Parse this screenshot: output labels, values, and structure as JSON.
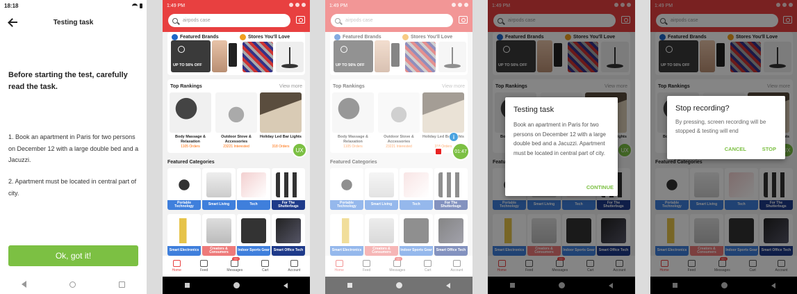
{
  "task_screen": {
    "status_time": "18:18",
    "title": "Testing task",
    "intro": "Before starting the test, carefully read the task.",
    "step1": "1. Book an apartment in Paris for two persons on December 12 with a large double bed and a Jacuzzi.",
    "step2": "2. Apartment must be located in central part of city.",
    "ok_button": "Ok, got it!"
  },
  "app": {
    "status_time": "1:49 PM",
    "search_placeholder": "airpods case",
    "featured_brands": "Featured Brands",
    "stores_love": "Stores You'll Love",
    "promo": "UP TO 56% OFF",
    "top_rankings": "Top Rankings",
    "view_more": "View more",
    "rankings": [
      {
        "name": "Body Massage & Relaxation",
        "stat": "1105 Orders"
      },
      {
        "name": "Outdoor Stove & Accessories",
        "stat": "23221 Interested"
      },
      {
        "name": "Holiday Led Bar Lights",
        "stat": "318 Orders"
      }
    ],
    "featured_categories": "Featured Categories",
    "categories": [
      "Portable Technology",
      "Smart Living",
      "Tech",
      "For The Shutterbugs",
      "Smart Electronics",
      "Creators & Consumers",
      "Indoor Sports Gear",
      "Smart Office Tech"
    ],
    "tabs": [
      "Home",
      "Feed",
      "Messages",
      "Cart",
      "Account"
    ],
    "messages_badge": "99+",
    "ux_button": "UX",
    "colors": {
      "brand_red": "#e84040",
      "accent_green": "#7cc043",
      "category_blue": "#3f7fdc"
    }
  },
  "recording": {
    "timer": "01:47",
    "info_icon": "i"
  },
  "task_dialog": {
    "title": "Testing task",
    "body": "Book an apartment in Paris for two persons on December 12 with a large double bed and a Jacuzzi. Apartment must be located in central part of city.",
    "button": "CONTINUE"
  },
  "stop_dialog": {
    "title": "Stop recording?",
    "body": "By pressing, screen recording will be stopped & testing will end",
    "cancel": "CANCEL",
    "stop": "STOP"
  }
}
